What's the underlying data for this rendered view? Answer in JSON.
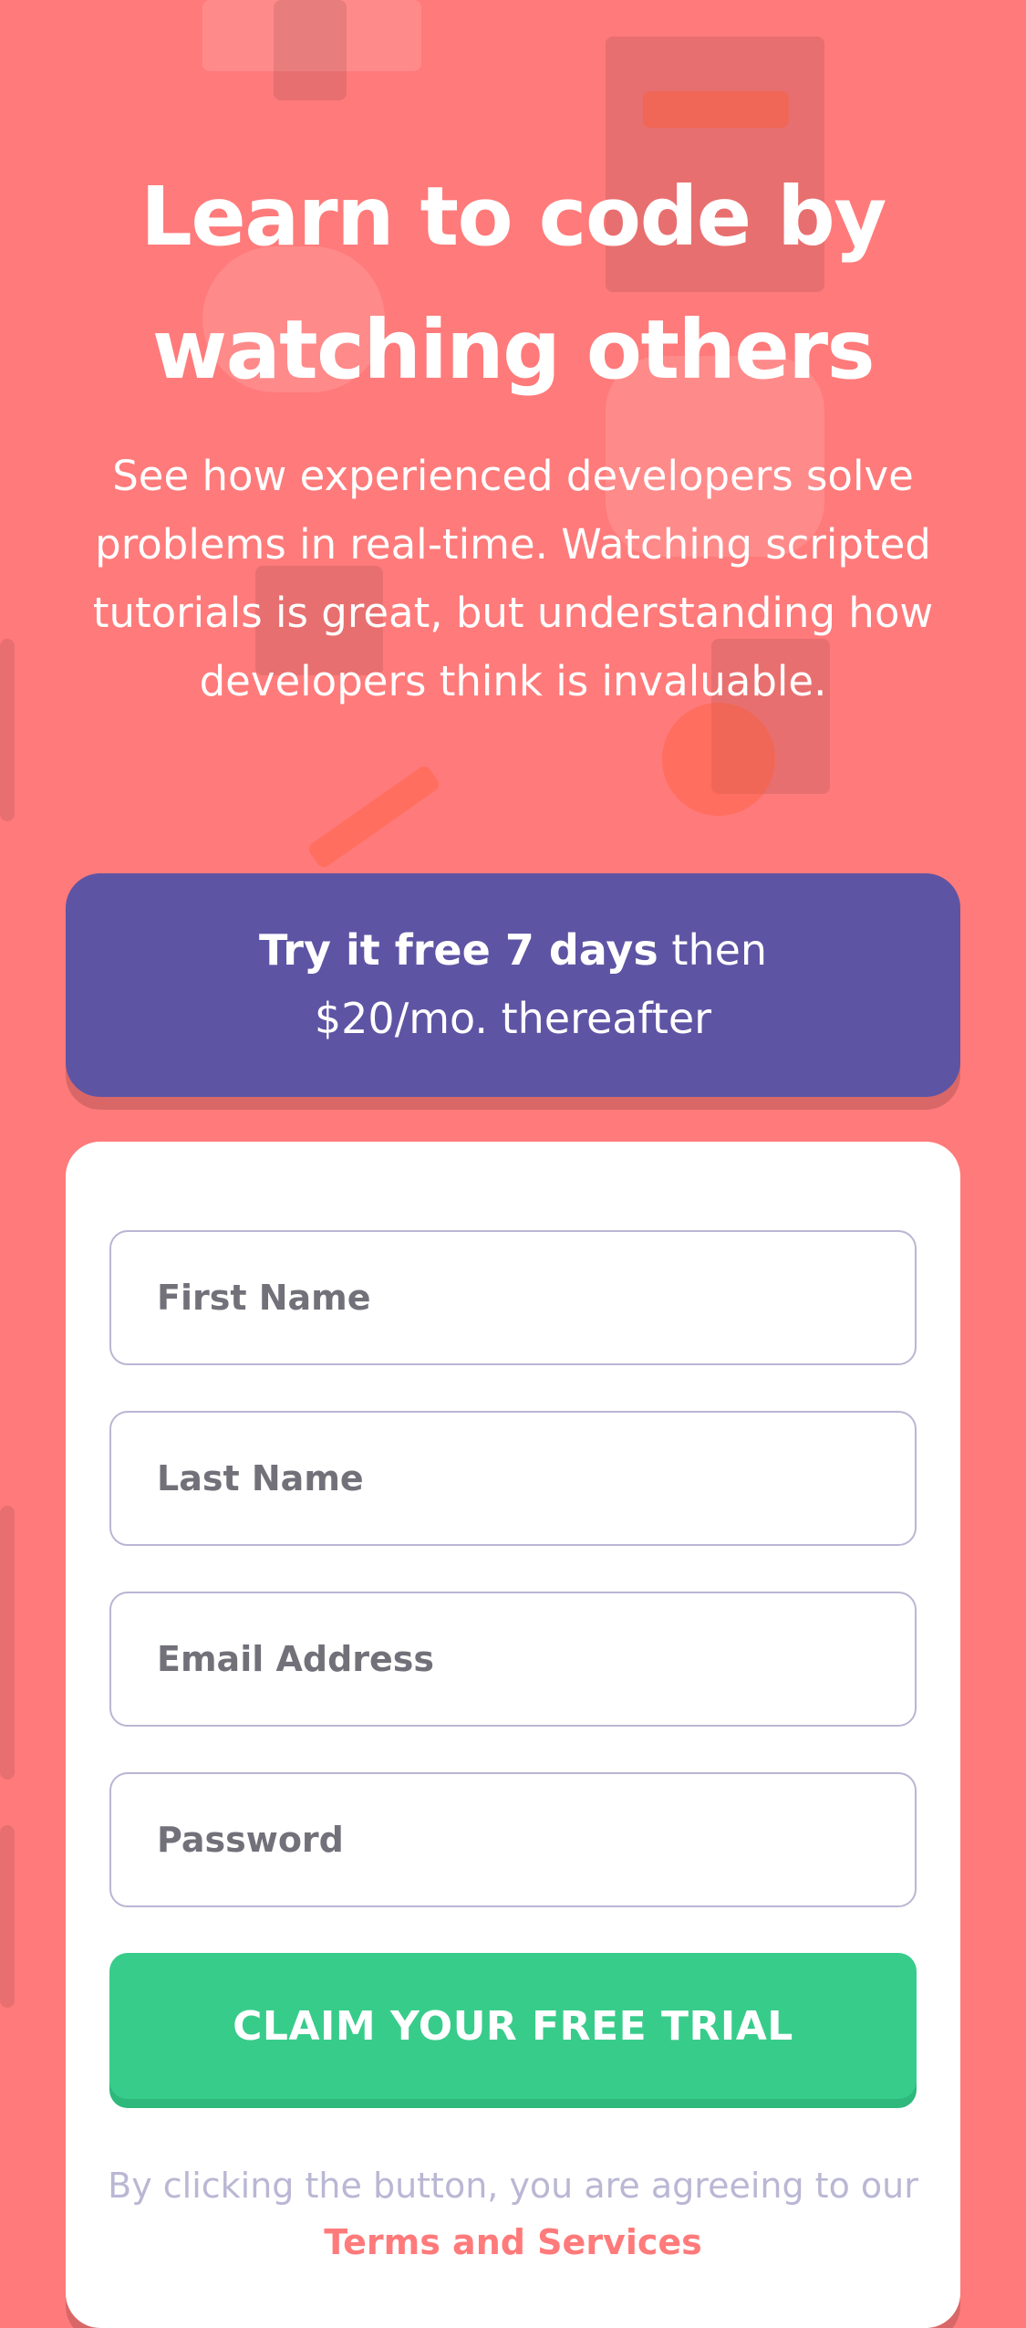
{
  "hero": {
    "headline_line1": "Learn to code by",
    "headline_line2": "watching others",
    "intro": "See how experienced developers solve problems in real-time. Watching scripted tutorials is great, but understanding how developers think is invaluable."
  },
  "promo": {
    "bold": "Try it free 7 days",
    "rest_line1": " then",
    "rest_line2": "$20/mo. thereafter"
  },
  "form": {
    "first_name_placeholder": "First Name",
    "last_name_placeholder": "Last Name",
    "email_placeholder": "Email Address",
    "password_placeholder": "Password",
    "submit_label": "CLAIM YOUR FREE TRIAL",
    "terms_prefix": "By clicking the button, you are agreeing to our ",
    "terms_link": "Terms and Services"
  },
  "colors": {
    "background": "#ff7a7a",
    "promo": "#5e54a4",
    "cta": "#38cc8b"
  }
}
